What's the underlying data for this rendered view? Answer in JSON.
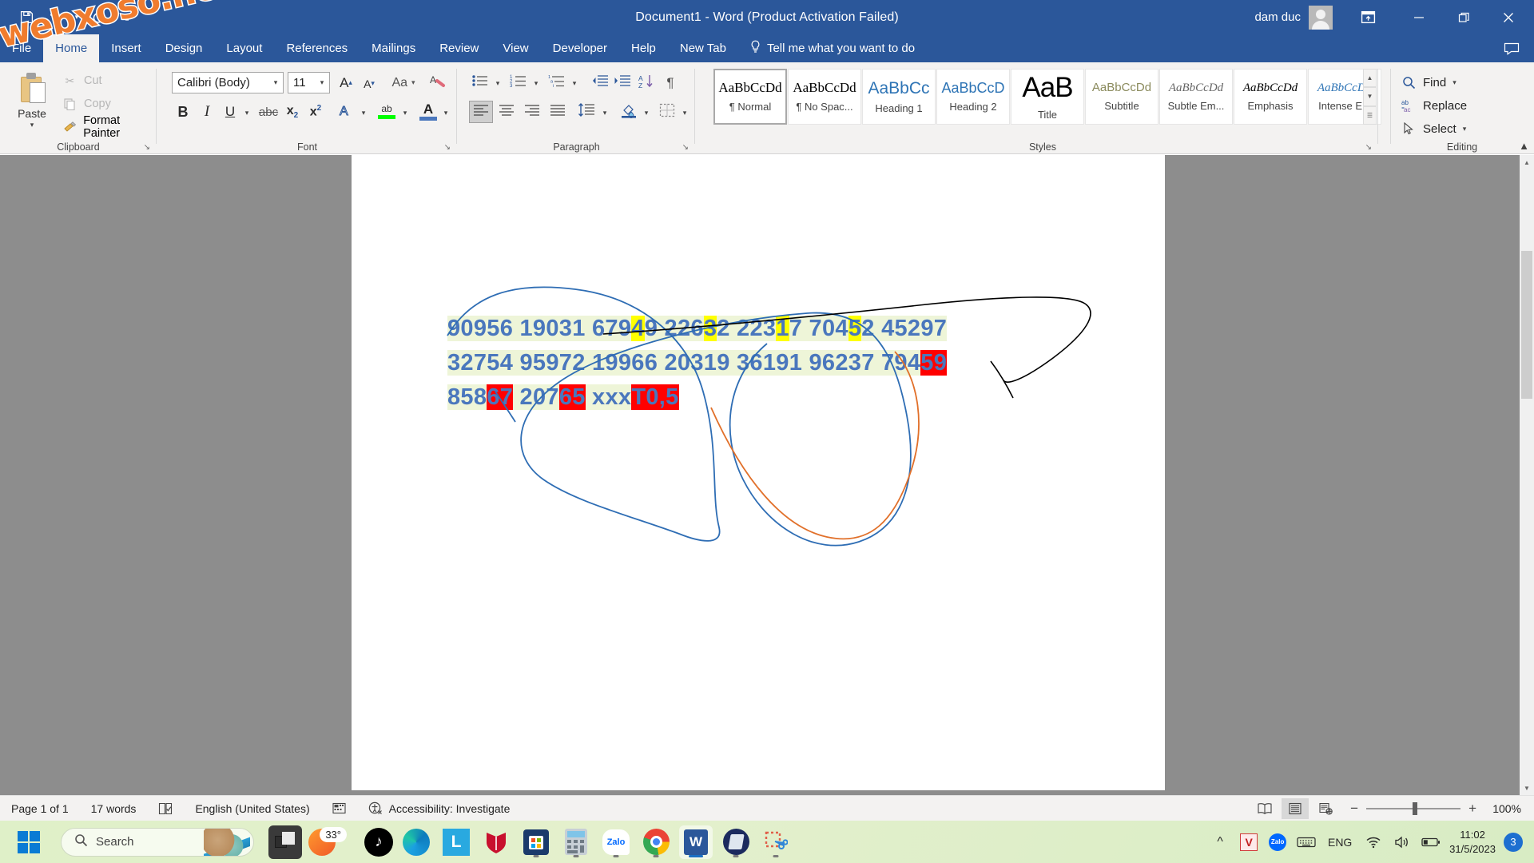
{
  "window": {
    "title": "Document1  -  Word (Product Activation Failed)",
    "user": "dam duc",
    "quick_access": [
      "save-icon",
      "undo-icon",
      "redo-icon",
      "customize-qat-icon"
    ],
    "controls": [
      "ribbon-display-options",
      "minimize",
      "restore",
      "close"
    ]
  },
  "watermark": {
    "text": "webxoso.net"
  },
  "tabs": [
    {
      "label": "File",
      "active": false
    },
    {
      "label": "Home",
      "active": true
    },
    {
      "label": "Insert",
      "active": false
    },
    {
      "label": "Design",
      "active": false
    },
    {
      "label": "Layout",
      "active": false
    },
    {
      "label": "References",
      "active": false
    },
    {
      "label": "Mailings",
      "active": false
    },
    {
      "label": "Review",
      "active": false
    },
    {
      "label": "View",
      "active": false
    },
    {
      "label": "Developer",
      "active": false
    },
    {
      "label": "Help",
      "active": false
    },
    {
      "label": "New Tab",
      "active": false
    }
  ],
  "tell_me": {
    "label": "Tell me what you want to do"
  },
  "ribbon": {
    "clipboard": {
      "group_label": "Clipboard",
      "paste": "Paste",
      "items": [
        {
          "label": "Cut",
          "icon": "scissors-icon",
          "disabled": true
        },
        {
          "label": "Copy",
          "icon": "copy-icon",
          "disabled": true
        },
        {
          "label": "Format Painter",
          "icon": "format-painter-icon",
          "disabled": false
        }
      ]
    },
    "font": {
      "group_label": "Font",
      "font_name": "Calibri (Body)",
      "font_size": "11",
      "buttons": [
        "grow-font-icon",
        "shrink-font-icon",
        "change-case-icon",
        "clear-formatting-icon",
        "bold-icon",
        "italic-icon",
        "underline-icon",
        "strikethrough-icon",
        "subscript-icon",
        "superscript-icon",
        "text-effects-icon",
        "text-highlight-color-icon",
        "font-color-icon"
      ],
      "bold_label": "B",
      "italic_label": "I",
      "underline_label": "U",
      "strike_label": "abc",
      "subscript_label": "x",
      "superscript_label": "x",
      "case_label": "Aa",
      "grow_label": "A",
      "shrink_label": "A",
      "effects_label": "A",
      "highlight_label": "ab",
      "fontcolor_label": "A"
    },
    "paragraph": {
      "group_label": "Paragraph",
      "buttons": [
        "bullets-icon",
        "numbering-icon",
        "multilevel-list-icon",
        "decrease-indent-icon",
        "increase-indent-icon",
        "sort-icon",
        "show-marks-icon",
        "align-left-icon",
        "align-center-icon",
        "align-right-icon",
        "justify-icon",
        "line-spacing-icon",
        "shading-icon",
        "borders-icon"
      ],
      "pilcrow": "¶"
    },
    "styles": {
      "group_label": "Styles",
      "items": [
        {
          "preview": "AaBbCcDd",
          "name": "¶ Normal",
          "selected": true
        },
        {
          "preview": "AaBbCcDd",
          "name": "¶ No Spac...",
          "selected": false
        },
        {
          "preview": "AaBbCc",
          "name": "Heading 1",
          "selected": false
        },
        {
          "preview": "AaBbCcD",
          "name": "Heading 2",
          "selected": false
        },
        {
          "preview": "AaB",
          "name": "Title",
          "selected": false
        },
        {
          "preview": "AaBbCcDd",
          "name": "Subtitle",
          "selected": false
        },
        {
          "preview": "AaBbCcDd",
          "name": "Subtle Em...",
          "selected": false
        },
        {
          "preview": "AaBbCcDd",
          "name": "Emphasis",
          "selected": false
        },
        {
          "preview": "AaBbCcDd",
          "name": "Intense E...",
          "selected": false
        }
      ]
    },
    "editing": {
      "group_label": "Editing",
      "items": [
        {
          "label": "Find",
          "icon": "search-icon",
          "caret": true
        },
        {
          "label": "Replace",
          "icon": "replace-icon",
          "caret": false
        },
        {
          "label": "Select",
          "icon": "select-pointer-icon",
          "caret": true
        }
      ]
    }
  },
  "document": {
    "lines": [
      [
        {
          "t": "90956 19031 679",
          "h": "green"
        },
        {
          "t": "4",
          "h": "yellow"
        },
        {
          "t": "9 226",
          "h": "green"
        },
        {
          "t": "3",
          "h": "yellow"
        },
        {
          "t": "2 223",
          "h": "green"
        },
        {
          "t": "1",
          "h": "yellow"
        },
        {
          "t": "7 704",
          "h": "green"
        },
        {
          "t": "5",
          "h": "yellow"
        },
        {
          "t": "2 45297",
          "h": "green"
        }
      ],
      [
        {
          "t": "32754 95972 19966 20319 36191 96237 794",
          "h": "green"
        },
        {
          "t": "59",
          "h": "red"
        }
      ],
      [
        {
          "t": "858",
          "h": "green"
        },
        {
          "t": "67",
          "h": "red"
        },
        {
          "t": " 207",
          "h": "green"
        },
        {
          "t": "65",
          "h": "red"
        },
        {
          "t": " xxx",
          "h": "green"
        },
        {
          "t": "T0,5",
          "h": "red"
        }
      ]
    ],
    "colors": {
      "text": "#4a77bd",
      "highlight_green": "#eef5d8",
      "highlight_yellow": "#ffff00",
      "highlight_red": "#ff0000",
      "ink_blue": "#2e6db4",
      "ink_orange": "#e1702a",
      "ink_black": "#000000"
    }
  },
  "status_bar": {
    "page": "Page 1 of 1",
    "words": "17 words",
    "language": "English (United States)",
    "accessibility": "Accessibility: Investigate",
    "zoom": "100%",
    "views": [
      "read-mode-icon",
      "print-layout-icon",
      "web-layout-icon"
    ],
    "icons": [
      "proofing-icon",
      "macro-recording-icon",
      "accessibility-icon"
    ]
  },
  "taskbar": {
    "search_placeholder": "Search",
    "apps": [
      {
        "name": "edge-icon",
        "label": "",
        "running": false
      },
      {
        "name": "lightshot-icon",
        "label": "L",
        "running": false
      },
      {
        "name": "mcafee-icon",
        "label": "",
        "running": false
      },
      {
        "name": "microsoft-store-icon",
        "label": "",
        "running": false
      },
      {
        "name": "calculator-icon",
        "label": "",
        "running": true
      },
      {
        "name": "zalo-icon",
        "label": "Zalo",
        "running": true
      },
      {
        "name": "chrome-icon",
        "label": "",
        "running": true
      },
      {
        "name": "word-icon",
        "label": "W",
        "running": true,
        "active": true
      },
      {
        "name": "foxit-reader-icon",
        "label": "",
        "running": true
      },
      {
        "name": "snipping-tool-icon",
        "label": "",
        "running": true
      }
    ],
    "weather": "33°",
    "tray": [
      "show-hidden-icons",
      "unikey-icon",
      "zalo-tray-icon",
      "keyboard-icon"
    ],
    "language": "ENG",
    "system": [
      "wifi-icon",
      "volume-icon",
      "battery-icon"
    ],
    "time": "11:02",
    "date": "31/5/2023",
    "notification_count": "3"
  }
}
